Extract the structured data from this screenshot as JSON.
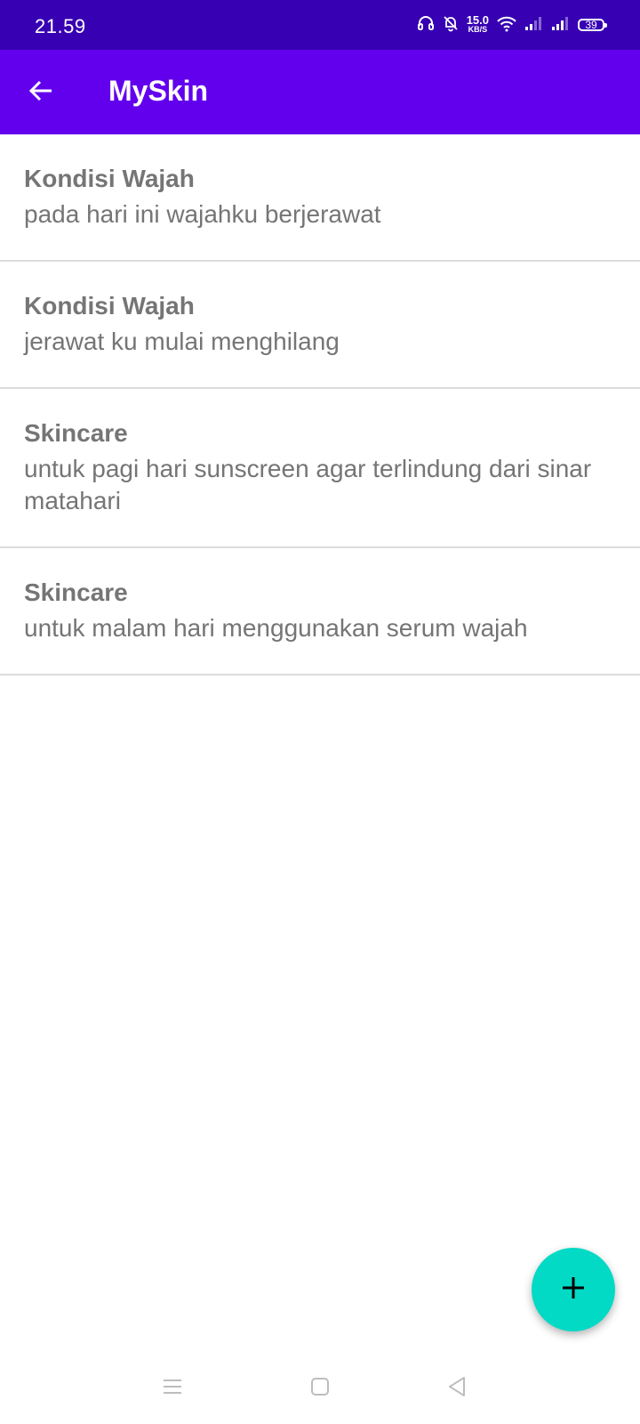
{
  "status_bar": {
    "time": "21.59",
    "net_speed_value": "15.0",
    "net_speed_unit": "KB/S",
    "battery_level": "39",
    "icons": [
      "headphones-icon",
      "bell-off-icon",
      "wifi-icon",
      "signal-icon",
      "signal-icon",
      "battery-icon"
    ]
  },
  "app_bar": {
    "title": "MySkin",
    "back_icon": "arrow-back-icon"
  },
  "list": {
    "items": [
      {
        "title": "Kondisi Wajah",
        "description": "pada hari ini wajahku berjerawat"
      },
      {
        "title": "Kondisi Wajah",
        "description": "jerawat ku mulai menghilang"
      },
      {
        "title": "Skincare",
        "description": "untuk pagi hari sunscreen agar terlindung dari sinar matahari"
      },
      {
        "title": "Skincare",
        "description": "untuk malam hari menggunakan serum wajah"
      }
    ]
  },
  "fab": {
    "icon": "plus-icon"
  },
  "nav_bar": {
    "icons": [
      "menu-icon",
      "home-icon",
      "back-icon"
    ]
  },
  "colors": {
    "status_bar": "#3700b3",
    "app_bar": "#6200ee",
    "fab": "#03dac5",
    "text": "#757575",
    "divider": "#dcdcdc"
  }
}
